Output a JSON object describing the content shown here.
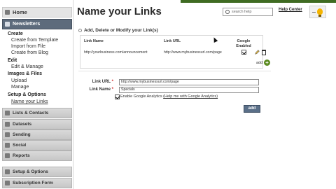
{
  "sidebar": {
    "home": "Home",
    "newsletters": "Newsletters",
    "sections": [
      {
        "title": "Create",
        "items": [
          "Create from Template",
          "Import from File",
          "Create from Blog"
        ]
      },
      {
        "title": "Edit",
        "items": [
          "Edit & Manage"
        ]
      },
      {
        "title": "Images & Files",
        "items": [
          "Upload",
          "Manage"
        ]
      },
      {
        "title": "Setup & Options",
        "items": [
          "Name your Links"
        ]
      }
    ],
    "groups": [
      "Lists & Contacts",
      "Datasets",
      "Sending",
      "Social",
      "Reports"
    ],
    "bottom_groups": [
      "Setup & Options",
      "Subscription Form"
    ]
  },
  "header": {
    "title": "Name your Links",
    "search_placeholder": "search help",
    "help_center": "Help Center"
  },
  "section": {
    "heading": "Add, Delete or Modify your Link(s)",
    "columns": {
      "name": "Link Name",
      "url": "Link URL",
      "ga": "Google Enabled"
    },
    "rows": [
      {
        "name": "http://yourbusiness.com/announcement",
        "url": "http://www.mybusinessurl.com/page",
        "ga": true
      }
    ],
    "add_label": "add"
  },
  "form": {
    "url_label": "Link URL",
    "name_label": "Link Name",
    "required_mark": "*",
    "url_value": "http://www.mybusinessurl.com/page",
    "name_value": "Specials",
    "ga_label": "Enable Google Analytics",
    "ga_link": "(Help me with Google Analytics)",
    "ga_checked": true,
    "submit_label": "add"
  }
}
